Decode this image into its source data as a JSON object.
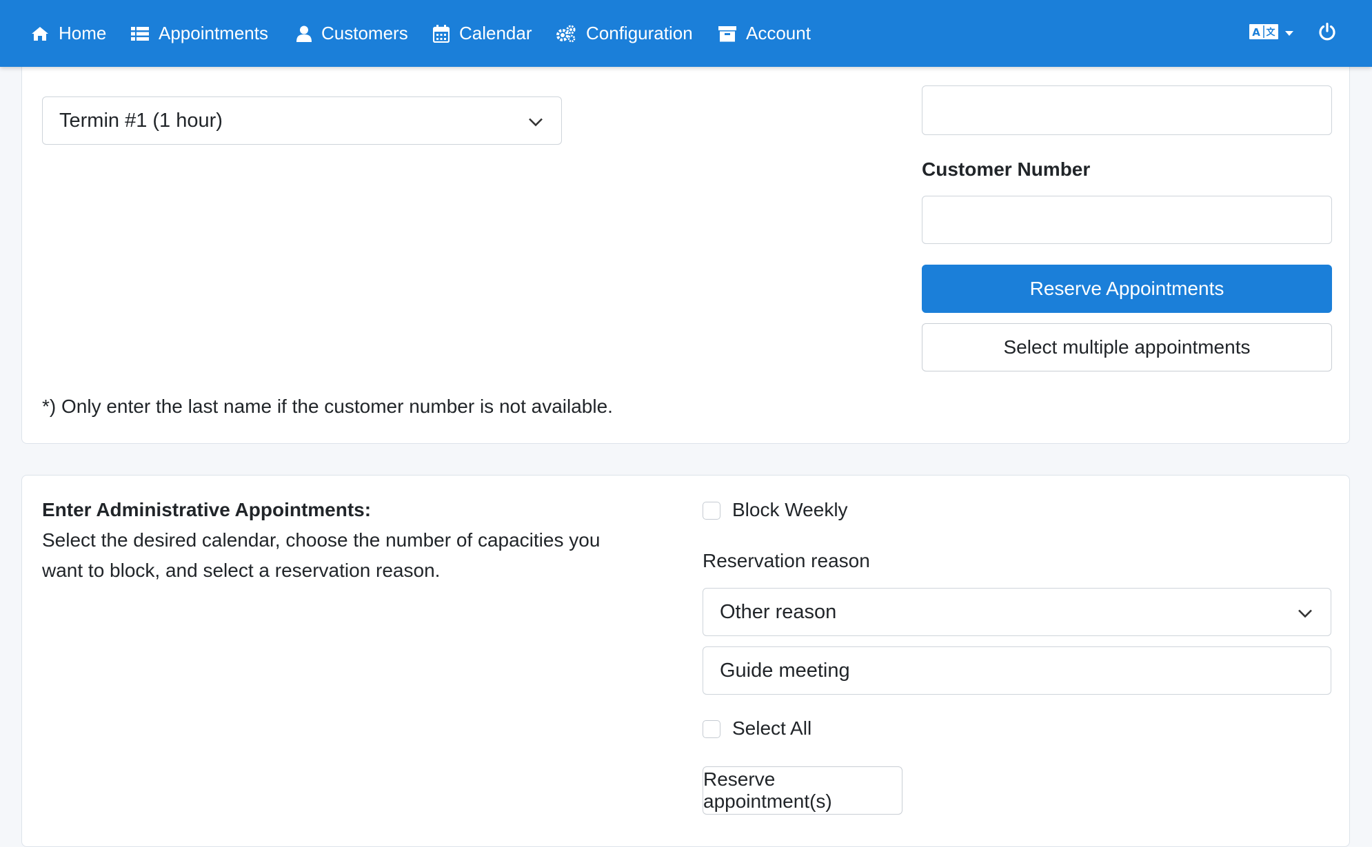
{
  "nav": {
    "items": [
      {
        "label": "Home",
        "icon": "home-icon"
      },
      {
        "label": "Appointments",
        "icon": "list-icon"
      },
      {
        "label": "Customers",
        "icon": "user-icon"
      },
      {
        "label": "Calendar",
        "icon": "calendar-icon"
      },
      {
        "label": "Configuration",
        "icon": "cogs-icon"
      },
      {
        "label": "Account",
        "icon": "archive-icon"
      }
    ],
    "language_icon": "translate-icon",
    "power_icon": "power-icon",
    "accent": "#1b7fd9"
  },
  "top_card": {
    "calendar_select": {
      "value": "Termin #1 (1 hour)"
    },
    "last_name_input": {
      "value": ""
    },
    "customer_number_label": "Customer Number",
    "customer_number_input": {
      "value": ""
    },
    "reserve_button": "Reserve Appointments",
    "multi_button": "Select multiple appointments",
    "footnote": "*) Only enter the last name if the customer number is not available."
  },
  "admin_card": {
    "heading": "Enter Administrative Appointments:",
    "desc_line1": "Select the desired calendar, choose the number of capacities you",
    "desc_line2": "want to block, and select a reservation reason.",
    "block_weekly_label": "Block Weekly",
    "reason_label": "Reservation reason",
    "reason_select": {
      "value": "Other reason"
    },
    "reason_text": {
      "value": "Guide meeting"
    },
    "select_all_label": "Select All",
    "reserve_button": "Reserve appointment(s)"
  }
}
